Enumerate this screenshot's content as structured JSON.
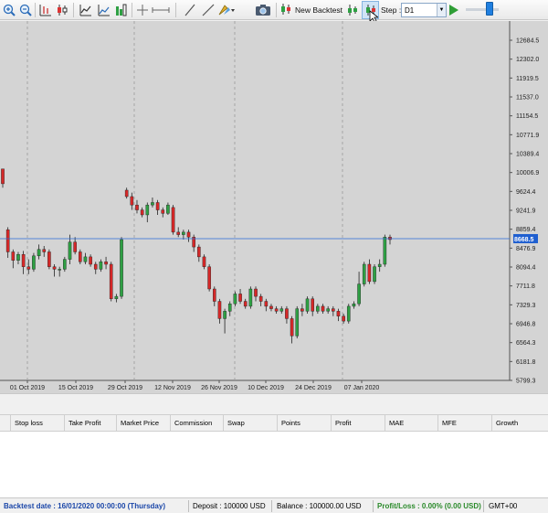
{
  "toolbar": {
    "new_backtest_label": "New Backtest",
    "step_label": "Step :",
    "step_value": "D1",
    "icons": [
      "zoom-in-icon",
      "zoom-out-icon",
      "bar-chart-icon",
      "candlestick-icon",
      "line-chart-icon",
      "volume-bars-icon",
      "crosshair-icon",
      "horizontal-line-icon",
      "vertical-line-icon",
      "trend-line-icon",
      "draw-tools-icon",
      "screenshot-icon",
      "new-backtest-icon",
      "step-icon",
      "play-icon"
    ]
  },
  "chart_data": {
    "type": "candlestick",
    "current_price_label": "8668.5",
    "y_ticks": [
      "12684.5",
      "12302.0",
      "11919.5",
      "11537.0",
      "11154.5",
      "10771.9",
      "10389.4",
      "10006.9",
      "9624.4",
      "9241.9",
      "8859.4",
      "8476.9",
      "8094.4",
      "7711.8",
      "7329.3",
      "6946.8",
      "6564.3",
      "6181.8",
      "5799.3"
    ],
    "x_ticks": [
      "01 Oct 2019",
      "15 Oct 2019",
      "29 Oct 2019",
      "12 Nov 2019",
      "26 Nov 2019",
      "10 Dec 2019",
      "24 Dec 2019",
      "07 Jan 2020"
    ],
    "ylim": [
      5799.3,
      12684.5
    ],
    "grid": "vertical",
    "bull_color": "#2ea043",
    "bear_color": "#d62828",
    "candles": [
      [
        10080,
        9780,
        10080,
        9700
      ],
      [
        8850,
        8400,
        8900,
        8280
      ],
      [
        8400,
        8230,
        8450,
        8070
      ],
      [
        8230,
        8350,
        8400,
        8150
      ],
      [
        8350,
        8100,
        8420,
        7950
      ],
      [
        8100,
        8050,
        8250,
        7950
      ],
      [
        8050,
        8320,
        8380,
        8000
      ],
      [
        8320,
        8450,
        8550,
        8250
      ],
      [
        8450,
        8400,
        8520,
        8300
      ],
      [
        8400,
        8100,
        8450,
        8050
      ],
      [
        8100,
        8050,
        8150,
        7900
      ],
      [
        8050,
        8050,
        8100,
        7900
      ],
      [
        8050,
        8250,
        8300,
        8000
      ],
      [
        8250,
        8600,
        8750,
        8150
      ],
      [
        8600,
        8400,
        8700,
        8350
      ],
      [
        8400,
        8200,
        8450,
        8150
      ],
      [
        8200,
        8300,
        8380,
        8150
      ],
      [
        8300,
        8150,
        8350,
        8100
      ],
      [
        8150,
        8050,
        8200,
        7950
      ],
      [
        8050,
        8200,
        8250,
        8000
      ],
      [
        8200,
        8150,
        8300,
        8050
      ],
      [
        8150,
        7450,
        8200,
        7400
      ],
      [
        7450,
        7500,
        7550,
        7380
      ],
      [
        7500,
        8650,
        8700,
        7450
      ],
      [
        9650,
        9520,
        9700,
        9480
      ],
      [
        9520,
        9350,
        9600,
        9250
      ],
      [
        9350,
        9250,
        9450,
        9180
      ],
      [
        9250,
        9150,
        9300,
        9100
      ],
      [
        9150,
        9350,
        9400,
        9000
      ],
      [
        9350,
        9400,
        9500,
        9300
      ],
      [
        9400,
        9250,
        9450,
        9150
      ],
      [
        9250,
        9180,
        9300,
        9100
      ],
      [
        9180,
        9350,
        9400,
        9150
      ],
      [
        9300,
        8800,
        9350,
        8750
      ],
      [
        8800,
        8750,
        8900,
        8700
      ],
      [
        8750,
        8800,
        8850,
        8650
      ],
      [
        8800,
        8700,
        8850,
        8600
      ],
      [
        8700,
        8500,
        8750,
        8400
      ],
      [
        8500,
        8300,
        8550,
        8200
      ],
      [
        8300,
        8100,
        8350,
        8050
      ],
      [
        8100,
        7650,
        8150,
        7600
      ],
      [
        7650,
        7400,
        7700,
        7300
      ],
      [
        7400,
        7050,
        7450,
        6950
      ],
      [
        7050,
        7200,
        7250,
        6750
      ],
      [
        7200,
        7350,
        7400,
        7100
      ],
      [
        7350,
        7550,
        7600,
        7300
      ],
      [
        7550,
        7400,
        7650,
        7350
      ],
      [
        7400,
        7300,
        7450,
        7250
      ],
      [
        7300,
        7650,
        7700,
        7250
      ],
      [
        7650,
        7500,
        7700,
        7400
      ],
      [
        7500,
        7400,
        7550,
        7300
      ],
      [
        7400,
        7300,
        7450,
        7200
      ],
      [
        7300,
        7250,
        7350,
        7200
      ],
      [
        7250,
        7200,
        7300,
        7150
      ],
      [
        7200,
        7250,
        7300,
        7150
      ],
      [
        7250,
        7050,
        7300,
        6950
      ],
      [
        7050,
        6700,
        7100,
        6550
      ],
      [
        6700,
        7250,
        7300,
        6650
      ],
      [
        7250,
        7200,
        7350,
        7100
      ],
      [
        7200,
        7450,
        7500,
        7150
      ],
      [
        7450,
        7200,
        7500,
        7100
      ],
      [
        7200,
        7300,
        7350,
        7150
      ],
      [
        7300,
        7200,
        7350,
        7150
      ],
      [
        7200,
        7250,
        7300,
        7150
      ],
      [
        7250,
        7200,
        7300,
        7100
      ],
      [
        7200,
        7100,
        7250,
        7000
      ],
      [
        7100,
        7000,
        7150,
        6950
      ],
      [
        7000,
        7300,
        7350,
        6950
      ],
      [
        7300,
        7350,
        7400,
        7250
      ],
      [
        7350,
        7750,
        8000,
        7300
      ],
      [
        7750,
        8150,
        8200,
        7700
      ],
      [
        8150,
        7800,
        8250,
        7750
      ],
      [
        7800,
        8100,
        8150,
        7750
      ],
      [
        8100,
        8150,
        8250,
        8000
      ],
      [
        8150,
        8700,
        8750,
        8100
      ],
      [
        8700,
        8650,
        8750,
        8550
      ]
    ]
  },
  "table": {
    "headers": [
      "Stop loss",
      "Take Profit",
      "Market Price",
      "Commission",
      "Swap",
      "Points",
      "Profit",
      "MAE",
      "MFE",
      "Growth"
    ]
  },
  "status": {
    "backtest_date": "Backtest date : 16/01/2020 00:00:00 (Thursday)",
    "deposit": "Deposit : 100000 USD",
    "balance": "Balance : 100000.00 USD",
    "profit_loss": "Profit/Loss : 0.00% (0.00 USD)",
    "timezone": "GMT+00"
  }
}
